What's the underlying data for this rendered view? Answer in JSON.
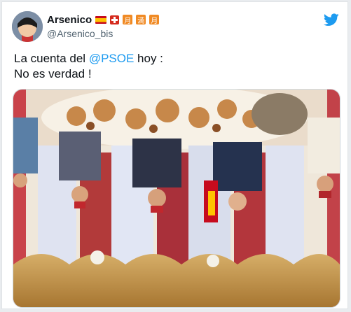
{
  "tweet": {
    "display_name": "Arsenico",
    "handle": "@Arsenico_bis",
    "badges": [
      "月",
      "満",
      "月"
    ],
    "text_before_mention": "La cuenta del ",
    "mention": "@PSOE",
    "text_after_mention": " hoy :",
    "line2": "No es verdad !"
  },
  "icons": {
    "logo": "twitter-bird-icon",
    "flag": "spain-flag-icon",
    "swiss": "swiss-flag-icon"
  },
  "colors": {
    "accent": "#1d9bf0",
    "text": "#0f1419",
    "muted": "#536471"
  }
}
